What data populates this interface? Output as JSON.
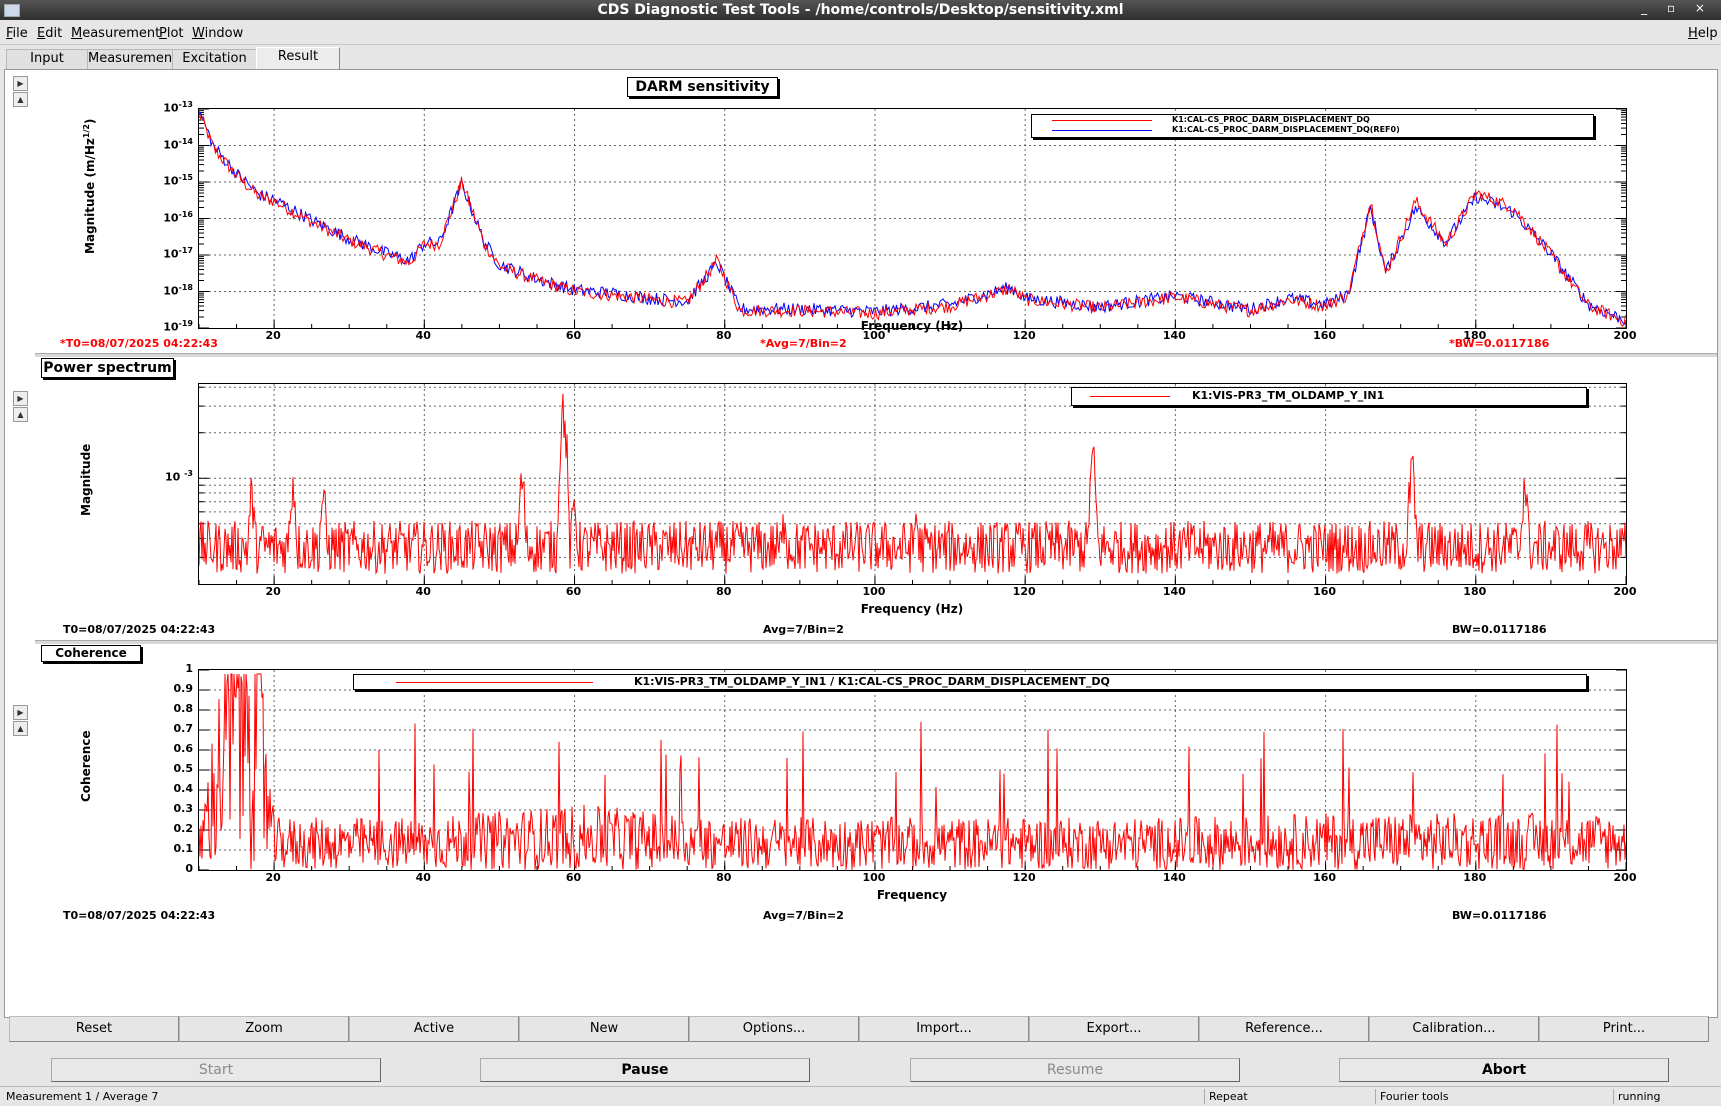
{
  "window": {
    "title": "CDS Diagnostic Test Tools - /home/controls/Desktop/sensitivity.xml",
    "controls": "_ ▫ ×"
  },
  "menubar": {
    "items": [
      "File",
      "Edit",
      "Measurement",
      "Plot",
      "Window"
    ],
    "help": "Help"
  },
  "tabs": [
    "Input",
    "Measurement",
    "Excitation",
    "Result"
  ],
  "active_tab": "Result",
  "plots": [
    {
      "title": "DARM sensitivity",
      "legend": [
        "K1:CAL-CS_PROC_DARM_DISPLACEMENT_DQ",
        "K1:CAL-CS_PROC_DARM_DISPLACEMENT_DQ(REF0)"
      ],
      "xlabel": "Frequency (Hz)",
      "ylabel": "Magnitude (m/Hz",
      "ylabel_sup": "1/2",
      "ylabel_end": ")",
      "info": {
        "t0": "*T0=08/07/2025 04:22:43",
        "avg": "*Avg=7/Bin=2",
        "bw": "*BW=0.0117186"
      }
    },
    {
      "title": "Power spectrum",
      "legend": [
        "K1:VIS-PR3_TM_OLDAMP_Y_IN1"
      ],
      "xlabel": "Frequency (Hz)",
      "ylabel": "Magnitude",
      "info": {
        "t0": "T0=08/07/2025 04:22:43",
        "avg": "Avg=7/Bin=2",
        "bw": "BW=0.0117186"
      }
    },
    {
      "title": "Coherence",
      "legend": [
        "K1:VIS-PR3_TM_OLDAMP_Y_IN1 / K1:CAL-CS_PROC_DARM_DISPLACEMENT_DQ"
      ],
      "xlabel": "Frequency",
      "ylabel": "Coherence",
      "info": {
        "t0": "T0=08/07/2025 04:22:43",
        "avg": "Avg=7/Bin=2",
        "bw": "BW=0.0117186"
      }
    }
  ],
  "chart_data": [
    {
      "type": "line",
      "title": "DARM sensitivity",
      "xlabel": "Frequency (Hz)",
      "ylabel": "Magnitude (m/Hz^1/2)",
      "xlim": [
        10,
        200
      ],
      "ylim": [
        1e-19,
        1e-13
      ],
      "yscale": "log",
      "grid": true,
      "legend_position": "top-right",
      "x_ticks": [
        "20",
        "40",
        "60",
        "80",
        "100",
        "120",
        "140",
        "160",
        "180",
        "200"
      ],
      "y_tick_mantissa": "10",
      "y_tick_exponents": [
        "-13",
        "-14",
        "-15",
        "-16",
        "-17",
        "-18",
        "-19"
      ],
      "colors": [
        "#ff0000",
        "#0000ff"
      ],
      "series": [
        {
          "name": "K1:CAL-CS_PROC_DARM_DISPLACEMENT_DQ",
          "x": [
            10,
            12,
            15,
            18,
            20,
            25,
            30,
            35,
            38,
            40,
            42,
            45,
            48,
            50,
            55,
            60,
            65,
            70,
            75,
            79,
            82,
            90,
            100,
            110,
            118,
            120,
            130,
            140,
            150,
            155,
            160,
            163,
            166,
            168,
            172,
            176,
            180,
            185,
            190,
            195,
            200
          ],
          "y": [
            8e-14,
            8e-15,
            1.5e-15,
            4e-16,
            3e-16,
            8e-17,
            2.5e-17,
            1e-17,
            6e-18,
            2e-17,
            2e-17,
            1e-15,
            2e-17,
            5e-18,
            2e-18,
            1e-18,
            8e-19,
            6e-19,
            5e-19,
            7e-18,
            3e-19,
            3e-19,
            2.5e-19,
            4e-19,
            1.2e-18,
            6e-19,
            3.5e-19,
            7e-19,
            3e-19,
            6e-19,
            4e-19,
            8e-19,
            3e-16,
            3e-18,
            3e-16,
            2e-17,
            5e-16,
            2e-16,
            1e-17,
            4e-19,
            1.5e-19
          ]
        },
        {
          "name": "K1:CAL-CS_PROC_DARM_DISPLACEMENT_DQ(REF0)",
          "x": [
            10,
            12,
            15,
            18,
            20,
            25,
            30,
            35,
            38,
            40,
            42,
            45,
            48,
            50,
            55,
            60,
            65,
            70,
            75,
            79,
            82,
            90,
            100,
            110,
            118,
            120,
            130,
            140,
            150,
            155,
            160,
            163,
            166,
            168,
            172,
            176,
            180,
            185,
            190,
            195,
            200
          ],
          "y": [
            9e-14,
            9e-15,
            1.7e-15,
            4.5e-16,
            3.3e-16,
            9e-17,
            2.8e-17,
            1.1e-17,
            7e-18,
            2.1e-17,
            2.1e-17,
            9e-16,
            2.2e-17,
            5.5e-18,
            2.2e-18,
            1.1e-18,
            9e-19,
            6.5e-19,
            5.5e-19,
            6e-18,
            3.3e-19,
            3.3e-19,
            2.8e-19,
            4.4e-19,
            1.3e-18,
            6.5e-19,
            3.8e-19,
            7.5e-19,
            3.3e-19,
            6.5e-19,
            4.4e-19,
            8.5e-19,
            2e-16,
            3.3e-18,
            2e-16,
            2.2e-17,
            4e-16,
            1.5e-16,
            1.1e-17,
            4.4e-19,
            1.6e-19
          ]
        }
      ]
    },
    {
      "type": "line",
      "title": "Power spectrum",
      "xlabel": "Frequency (Hz)",
      "ylabel": "Magnitude",
      "xlim": [
        10,
        200
      ],
      "yscale": "log",
      "grid": true,
      "legend_position": "top-right",
      "x_ticks": [
        "20",
        "40",
        "60",
        "80",
        "100",
        "120",
        "140",
        "160",
        "180",
        "200"
      ],
      "y_tick_mantissa": "10",
      "y_tick_exponents": [
        "-3"
      ],
      "colors": [
        "#ff0000"
      ],
      "series": [
        {
          "name": "K1:VIS-PR3_TM_OLDAMP_Y_IN1",
          "baseline": 0.00035,
          "peaks": [
            [
              17,
              0.0008
            ],
            [
              22.5,
              0.001
            ],
            [
              26.5,
              0.0008
            ],
            [
              53,
              0.001
            ],
            [
              58.5,
              0.003
            ],
            [
              60,
              0.0007
            ],
            [
              88,
              0.0006
            ],
            [
              105.5,
              0.0006
            ],
            [
              129,
              0.0014
            ],
            [
              171.5,
              0.0012
            ],
            [
              186.5,
              0.001
            ]
          ]
        }
      ]
    },
    {
      "type": "line",
      "title": "Coherence",
      "xlabel": "Frequency",
      "ylabel": "Coherence",
      "xlim": [
        10,
        200
      ],
      "ylim": [
        0,
        1
      ],
      "grid": true,
      "legend_position": "top",
      "x_ticks": [
        "20",
        "40",
        "60",
        "80",
        "100",
        "120",
        "140",
        "160",
        "180",
        "200"
      ],
      "y_ticks": [
        "0",
        "0.1",
        "0.2",
        "0.3",
        "0.4",
        "0.5",
        "0.6",
        "0.7",
        "0.8",
        "0.9",
        "1"
      ],
      "colors": [
        "#ff0000"
      ],
      "series": [
        {
          "name": "K1:VIS-PR3_TM_OLDAMP_Y_IN1 / K1:CAL-CS_PROC_DARM_DISPLACEMENT_DQ",
          "x": [
            10,
            12,
            14,
            16,
            17,
            18,
            19,
            20,
            40,
            60,
            80,
            100,
            120,
            140,
            160,
            180,
            200
          ],
          "y": [
            0.1,
            0.35,
            0.6,
            0.8,
            0.93,
            0.7,
            0.3,
            0.12,
            0.12,
            0.15,
            0.12,
            0.12,
            0.12,
            0.12,
            0.13,
            0.13,
            0.13
          ]
        }
      ]
    }
  ],
  "buttons": [
    "Reset",
    "Zoom",
    "Active",
    "New",
    "Options...",
    "Import...",
    "Export...",
    "Reference...",
    "Calibration...",
    "Print..."
  ],
  "control_buttons": {
    "start": "Start",
    "pause": "Pause",
    "resume": "Resume",
    "abort": "Abort"
  },
  "status": {
    "left": "Measurement 1 / Average 7",
    "repeat": "Repeat",
    "tool": "Fourier tools",
    "state": "running"
  }
}
